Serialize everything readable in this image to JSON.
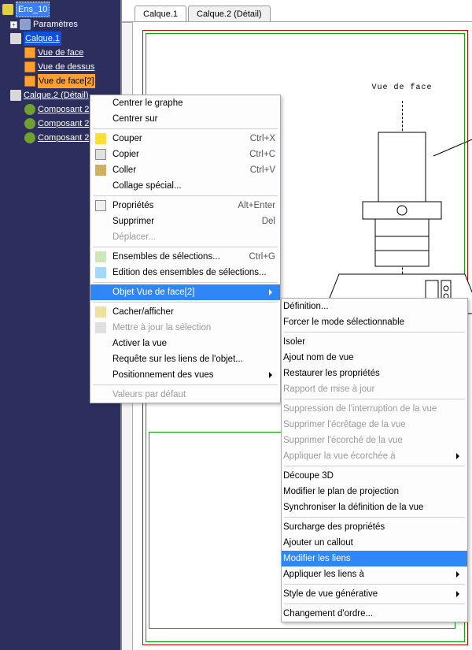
{
  "tree": {
    "root": "Ens_10",
    "params": "Paramètres",
    "layer1": "Calque.1",
    "views": [
      "Vue de face",
      "Vue de dessus",
      "Vue de face[2]"
    ],
    "layer2": "Calque.2 (Détail)",
    "components": [
      "Composant 2",
      "Composant 2",
      "Composant 2"
    ]
  },
  "tabs": {
    "t1": "Calque.1",
    "t2": "Calque.2 (Détail)"
  },
  "drawing": {
    "caption": "Vue de face"
  },
  "menu1": {
    "centerGraph": "Centrer le graphe",
    "centerOn": "Centrer sur",
    "cut": {
      "label": "Couper",
      "sc": "Ctrl+X"
    },
    "copy": {
      "label": "Copier",
      "sc": "Ctrl+C"
    },
    "paste": {
      "label": "Coller",
      "sc": "Ctrl+V"
    },
    "pasteSpecial": "Collage spécial...",
    "props": {
      "label": "Propriétés",
      "sc": "Alt+Enter"
    },
    "delete": {
      "label": "Supprimer",
      "sc": "Del"
    },
    "move": "Déplacer...",
    "selSets": {
      "label": "Ensembles de sélections...",
      "sc": "Ctrl+G"
    },
    "editSets": "Edition des ensembles de sélections...",
    "object": "Objet Vue de face[2]",
    "hideShow": "Cacher/afficher",
    "updateSel": "Mettre à jour la sélection",
    "activate": "Activer la vue",
    "queryLinks": "Requête sur les liens de l'objet...",
    "positioning": "Positionnement des vues",
    "defaults": "Valeurs par défaut"
  },
  "menu2": {
    "definition": "Définition...",
    "forceSel": "Forcer le mode sélectionnable",
    "isolate": "Isoler",
    "addName": "Ajout nom de vue",
    "restore": "Restaurer les propriétés",
    "updateReport": "Rapport de mise à jour",
    "suppInterrupt": "Suppression de l'interruption de la vue",
    "suppClip": "Supprimer l'écrêtage de la vue",
    "suppFlay": "Supprimer l'écorché de la vue",
    "applyFlay": "Appliquer la vue écorchée à",
    "cut3d": "Découpe 3D",
    "modProj": "Modifier le plan de projection",
    "syncDef": "Synchroniser la définition de la vue",
    "overrideProps": "Surcharge des propriétés",
    "addCallout": "Ajouter un callout",
    "modLinks": "Modifier les liens",
    "applyLinks": "Appliquer les liens à",
    "genStyle": "Style de vue générative",
    "changeOrder": "Changement d'ordre..."
  }
}
